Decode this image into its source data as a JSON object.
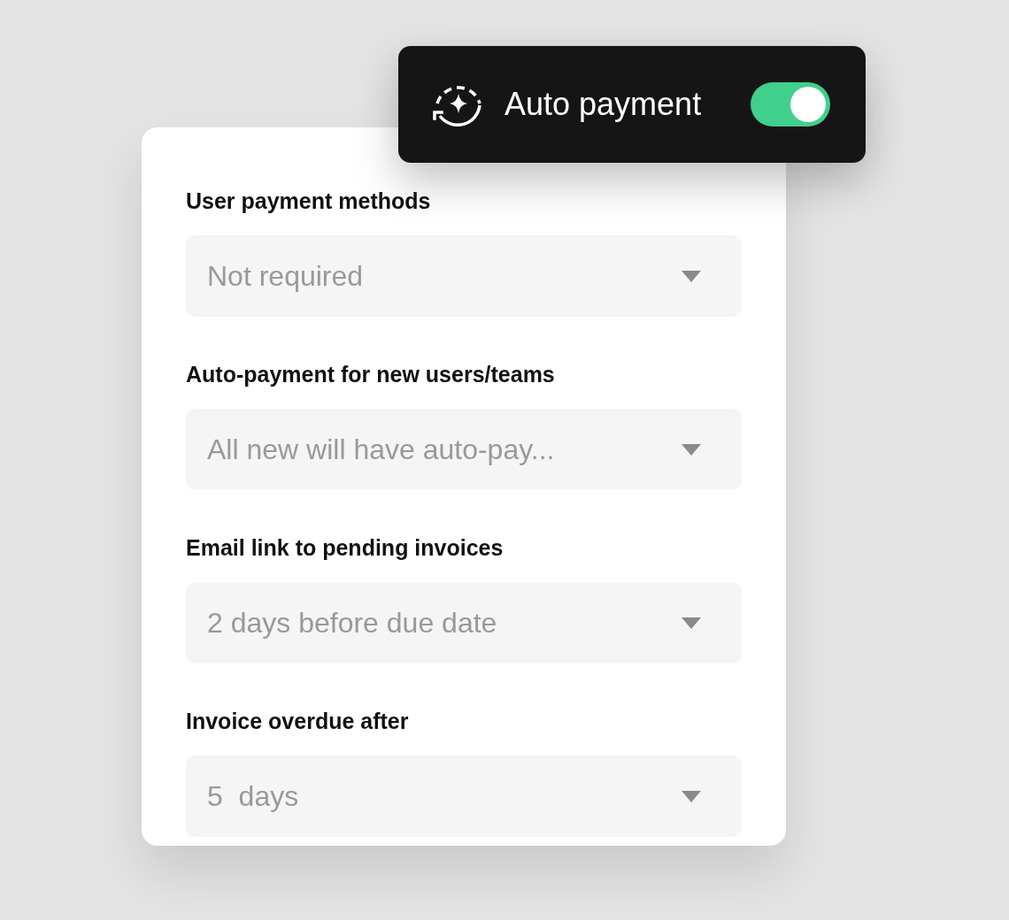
{
  "auto_payment": {
    "label": "Auto payment",
    "on": true
  },
  "fields": [
    {
      "label": "User payment methods",
      "value": "Not required"
    },
    {
      "label": "Auto-payment for new users/teams",
      "value": "All new will have auto-pay..."
    },
    {
      "label": "Email link to pending invoices",
      "value": "2 days before due date"
    },
    {
      "label": "Invoice overdue after",
      "value": "5  days"
    }
  ]
}
